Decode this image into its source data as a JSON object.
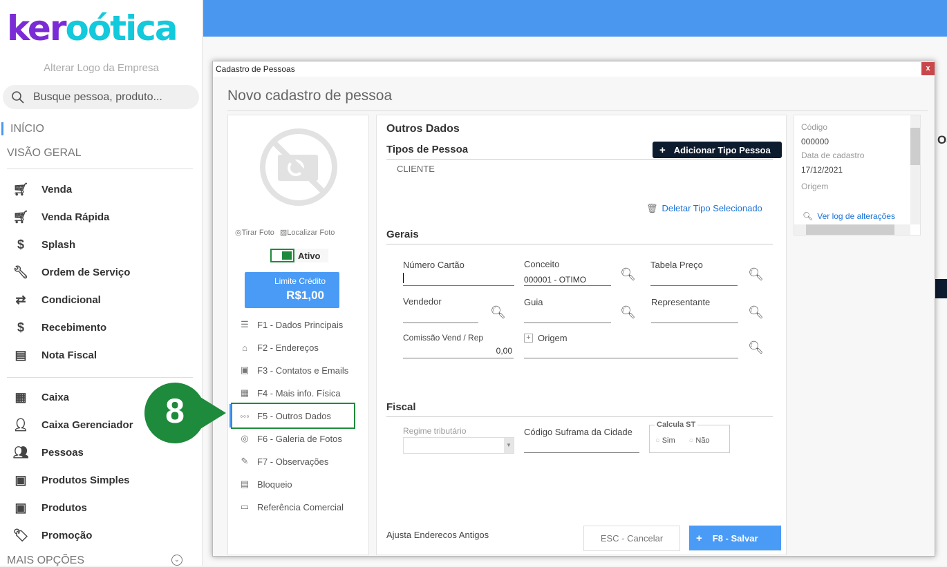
{
  "sidebar": {
    "logo_text_a": "ker",
    "logo_text_b": "oótica",
    "change_logo": "Alterar Logo da Empresa",
    "search_placeholder": "Busque pessoa, produto...",
    "inicio": "INÍCIO",
    "visao_geral": "VISÃO GERAL",
    "items1": [
      {
        "label": "Venda",
        "icon": "cart-icon"
      },
      {
        "label": "Venda Rápida",
        "icon": "cart-fast-icon"
      },
      {
        "label": "Splash",
        "icon": "cart-dollar-icon"
      },
      {
        "label": "Ordem de Serviço",
        "icon": "wrench-icon"
      },
      {
        "label": "Condicional",
        "icon": "cart-arrows-icon"
      },
      {
        "label": "Recebimento",
        "icon": "hand-money-icon"
      },
      {
        "label": "Nota Fiscal",
        "icon": "nfe-icon"
      }
    ],
    "items2": [
      {
        "label": "Caixa",
        "icon": "cash-register-icon"
      },
      {
        "label": "Caixa Gerenciador",
        "icon": "user-dollar-icon"
      },
      {
        "label": "Pessoas",
        "icon": "users-icon"
      },
      {
        "label": "Produtos Simples",
        "icon": "box-icon"
      },
      {
        "label": "Produtos",
        "icon": "box-icon"
      },
      {
        "label": "Promoção",
        "icon": "tag-icon"
      }
    ],
    "mais_opcoes": "MAIS OPÇÕES"
  },
  "modal": {
    "window_title": "Cadastro de Pessoas",
    "close": "x",
    "heading": "Novo cadastro de pessoa",
    "left": {
      "tirar_foto": "Tirar Foto",
      "localizar_foto": "Localizar Foto",
      "ativo": "Ativo",
      "ativo_on": true,
      "limite_label": "Limite Crédito",
      "limite_value": "R$1,00",
      "menu": [
        "F1 - Dados Principais",
        "F2 - Endereços",
        "F3 - Contatos e Emails",
        "F4 - Mais info. Física",
        "F5 - Outros Dados",
        "F6 - Galeria de Fotos",
        "F7 - Observações",
        "Bloqueio",
        "Referência Comercial"
      ],
      "active_menu": "F5 - Outros Dados"
    },
    "main": {
      "title": "Outros Dados",
      "tipos_title": "Tipos de Pessoa",
      "add_tipo": "Adicionar Tipo Pessoa",
      "tipos": [
        "CLIENTE"
      ],
      "delete_tipo": "Deletar Tipo Selecionado",
      "gerais_title": "Gerais",
      "numero_cartao": "Número Cartão",
      "numero_cartao_value": "",
      "conceito": "Conceito",
      "conceito_value": "000001 - OTIMO",
      "tabela_preco": "Tabela Preço",
      "vendedor": "Vendedor",
      "guia": "Guia",
      "representante": "Representante",
      "comissao": "Comissão Vend / Rep",
      "comissao_value": "0,00",
      "origem": "Origem",
      "fiscal_title": "Fiscal",
      "regime": "Regime tributário",
      "suframa": "Código Suframa da Cidade",
      "calcula_st": "Calcula ST",
      "sim": "Sim",
      "nao": "Não",
      "ajusta": "Ajusta Enderecos Antigos",
      "cancel": "ESC - Cancelar",
      "save": "F8 - Salvar"
    },
    "right": {
      "codigo_label": "Código",
      "codigo": "000000",
      "data_label": "Data de cadastro",
      "data": "17/12/2021",
      "origem_label": "Origem",
      "ver_log": "Ver log de alterações"
    }
  },
  "annotation": {
    "step": "8",
    "color": "#1e8a3c"
  },
  "colors": {
    "accent": "#4a97f0",
    "primary_button": "#4a9bf5",
    "dark_button": "#0d1b2e",
    "active_green": "#1e8a3c"
  }
}
